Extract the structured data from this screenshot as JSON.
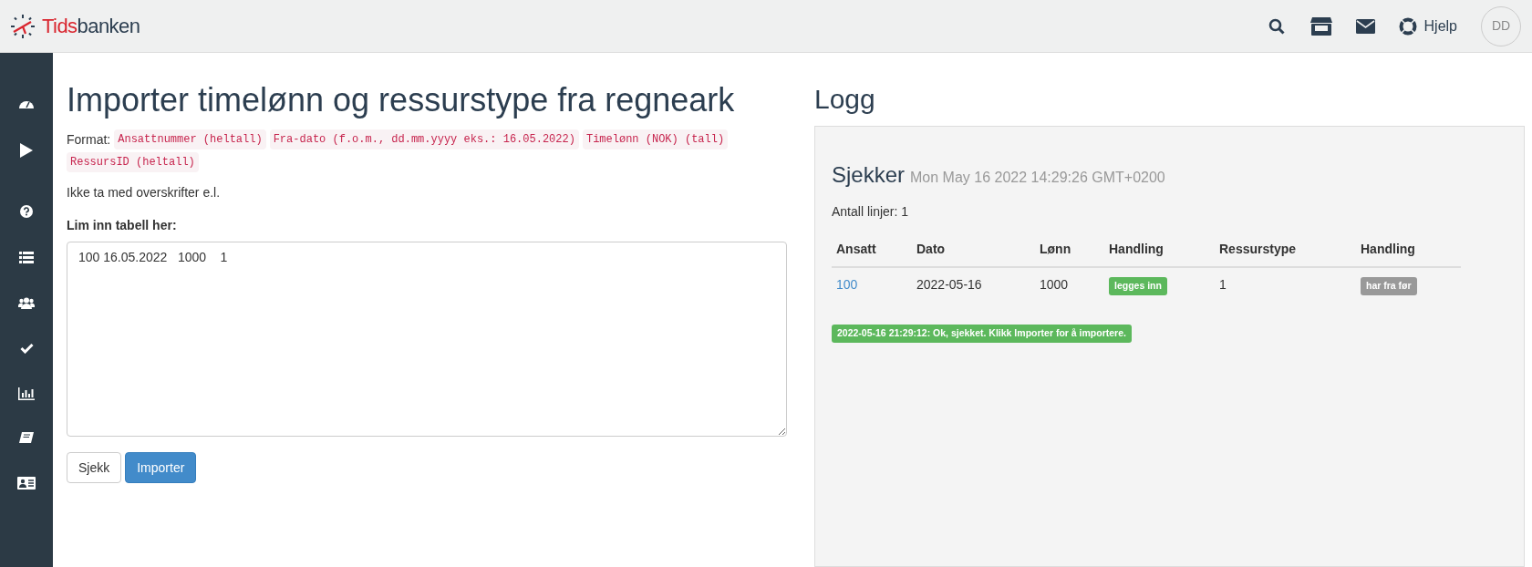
{
  "header": {
    "logo": {
      "part_1": "Tids",
      "part_2": "banken"
    },
    "help_label": "Hjelp",
    "avatar_initials": "DD"
  },
  "import_panel": {
    "title": "Importer timelønn og ressurstype fra regneark",
    "format_label": "Format:",
    "format_fields": [
      "Ansattnummer (heltall)",
      "Fra-dato (f.o.m., dd.mm.yyyy eks.: 16.05.2022)",
      "Timelønn (NOK) (tall)",
      "RessursID (heltall)"
    ],
    "note": "Ikke ta med overskrifter e.l.",
    "paste_label": "Lim inn tabell her:",
    "paste_value": "100 16.05.2022\t1000\t1",
    "buttons": [
      {
        "label": "Sjekk",
        "kind": "default"
      },
      {
        "label": "Importer",
        "kind": "primary"
      }
    ]
  },
  "log_panel": {
    "title": "Logg",
    "check_title": "Sjekker",
    "check_time": "Mon May 16 2022 14:29:26 GMT+0200",
    "line_count": "Antall linjer: 1",
    "table": {
      "columns": [
        "Ansatt",
        "Dato",
        "Lønn",
        "Handling",
        "Ressurstype",
        "Handling"
      ],
      "rows": [
        [
          {
            "text": "100",
            "kind": "link"
          },
          {
            "text": "2022-05-16",
            "kind": "text"
          },
          {
            "text": "1000",
            "kind": "text"
          },
          {
            "text": "legges inn",
            "kind": "badge",
            "color": "#5cb85c"
          },
          {
            "text": "1",
            "kind": "text"
          },
          {
            "text": "har fra før",
            "kind": "badge",
            "color": "#999999"
          }
        ]
      ]
    },
    "message": {
      "text": "2022-05-16 21:29:12: Ok, sjekket. Klikk Importer for å importere.",
      "color": "#5cb85c"
    }
  }
}
